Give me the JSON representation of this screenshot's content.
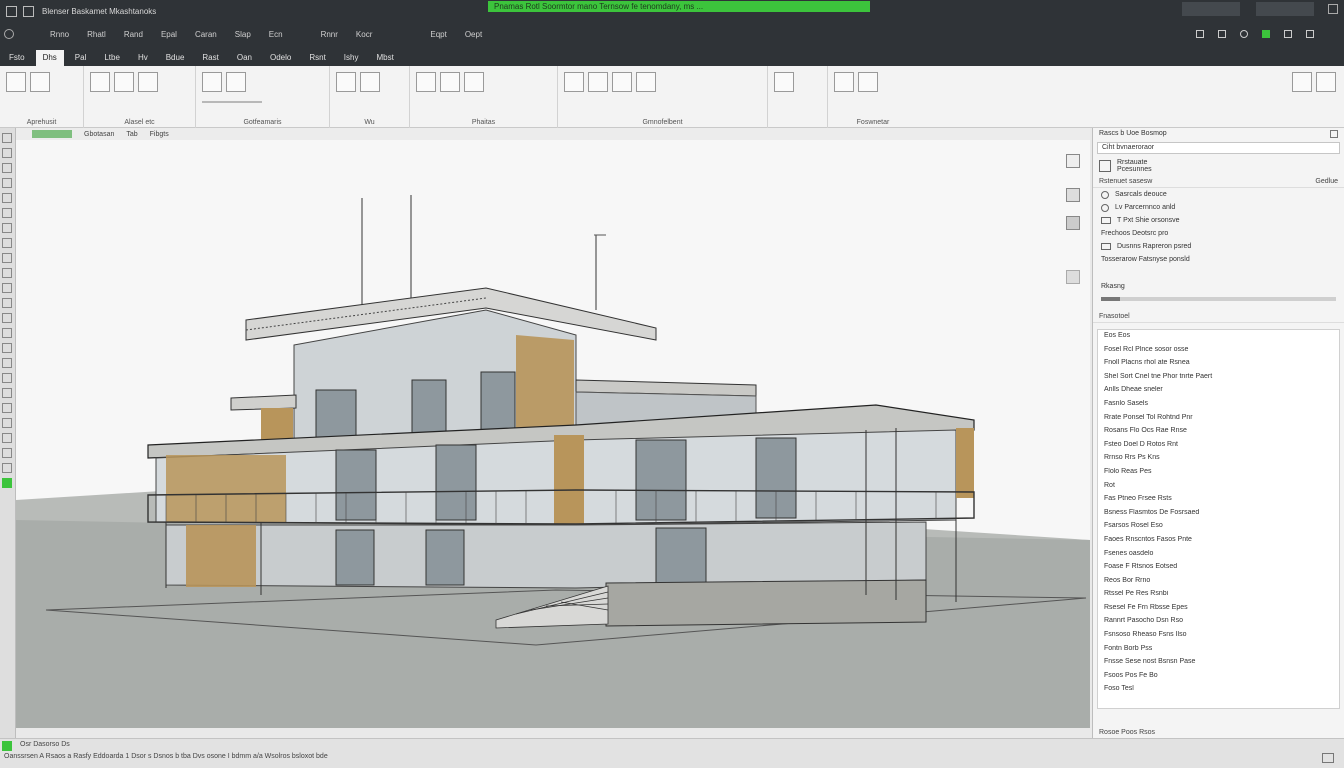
{
  "titlebar": {
    "app_title": "Blenser Baskamet Mkashtanoks",
    "banner": "Pnamas Rotl Soormtor mano Ternsow fe tenomdany, ms ..."
  },
  "menu": [
    "Rnno",
    "Rhatl",
    "Rand",
    "Epal",
    "Caran",
    "Slap",
    "Ecn",
    "Rnnr",
    "Kocr",
    "Eqpt",
    "Oept"
  ],
  "tabs": [
    "Fsto",
    "Dhs",
    "Pal",
    "Ltbe",
    "Hv",
    "Bdue",
    "Rast",
    "Oan",
    "Odelo",
    "Rsnt",
    "Ishy",
    "Mbst"
  ],
  "ribbon": {
    "groups": [
      "Aprehusit",
      "Alasel etc",
      "Gotfeamaris",
      "Wu",
      "Phaitas",
      "Gmnofelbent",
      "Foswnetar"
    ]
  },
  "view": {
    "tabs": [
      "Gbotasan",
      "Tab",
      "Fibgts"
    ]
  },
  "properties": {
    "title": "Rascs b Uoe Bosmop",
    "search": "Ciht bvnaeroraor",
    "type_line1": "Rrstauate",
    "type_line2": "Pcesunnes",
    "section1": "Rstenuet sasesw",
    "section1_right": "Gedlue",
    "options": [
      "Sasrcals deouce",
      "Lv Parcernnco anld",
      "T Pxt Shie orsonsve",
      "Frechoos Deotsrc pro",
      "Dusnns Rapreron psred",
      "Tosserarow Fatsnyse ponsld"
    ],
    "slider_label": "Rkasng",
    "section2": "Fnasotoel",
    "items": [
      "Eos Eos",
      "Fosel Rcl Plnce sosor osse",
      "Fnoll Placns rhol ate Rsnea",
      "Shel Sort Cnel tne Phor tnrte Paert",
      "Anlls Dheae sneler",
      "Fasnlo Sasels",
      "Rrate Ponsel Tol Rohtnd Pnr",
      "Rosans Flo Ocs Rae Rnse",
      "Fsteo Doel D Rotos Rnt",
      "Rrnso Rrs Ps Kns",
      "Flolo Reas Pes",
      "Rot",
      "Fas Ptneo Frsee Rsts",
      "Bsness Flasmtos De Fosrsaed",
      "Fsarsos Rosel Eso",
      "Faoes Rnscntos Fasos Pnte",
      "Fsenes oasdelo",
      "Foase F Rtsnos Eotsed",
      "Reos Bor Rrno",
      "Rtssel Pe Res Rsnbi",
      "Rsesel Fe Frn Rbsse Epes",
      "Rannrt Pasocho Dsn Rso",
      "Fsnsoso Rheaso Fsns Ilso",
      "Fontn Borb Pss",
      "Fnsse Sese nost Bsnsn Pase",
      "Fsoos Pos Fe Bo",
      "Foso Tesl"
    ],
    "bottom": "Rosoe Poos Rsos"
  },
  "status": {
    "left_line": "Osr Dasorso Ds",
    "bottom_line": "Oanssrsen A Rsaos  a Rasfy Eddoarda  1 Dsor  s Dsnos  b tba Dvs osone I bdmm a/a Wsolros  bsloxot bde"
  },
  "colors": {
    "chrome": "#2f3337",
    "accent": "#3cc43c",
    "wood": "#b8955b"
  }
}
